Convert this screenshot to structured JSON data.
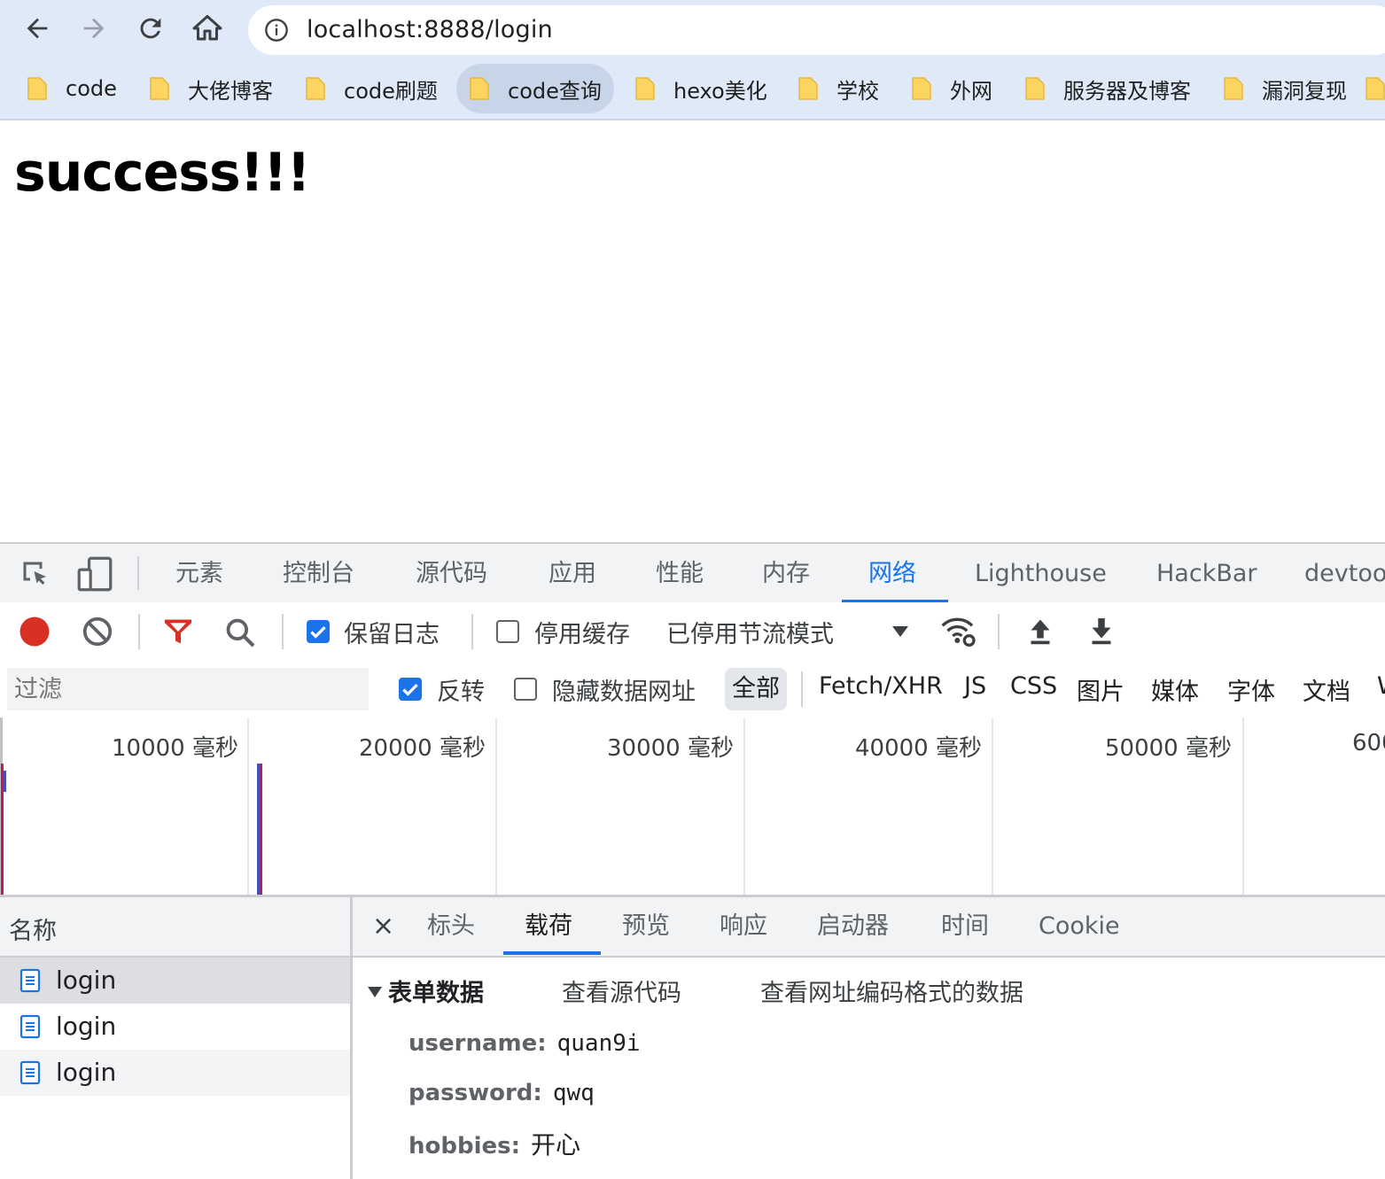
{
  "browser": {
    "url": "localhost:8888/login",
    "bookmarks": [
      {
        "label": "code"
      },
      {
        "label": "大佬博客"
      },
      {
        "label": "code刷题"
      },
      {
        "label": "code查询"
      },
      {
        "label": "hexo美化"
      },
      {
        "label": "学校"
      },
      {
        "label": "外网"
      },
      {
        "label": "服务器及博客"
      },
      {
        "label": "漏洞复现"
      }
    ]
  },
  "page": {
    "heading": "success!!!"
  },
  "devtools": {
    "tabs": [
      "元素",
      "控制台",
      "源代码",
      "应用",
      "性能",
      "内存",
      "网络",
      "Lighthouse",
      "HackBar",
      "devtoo"
    ],
    "active_tab": "网络",
    "toolbar": {
      "preserve_log_label": "保留日志",
      "preserve_log_checked": true,
      "disable_cache_label": "停用缓存",
      "disable_cache_checked": false,
      "throttling_label": "已停用节流模式"
    },
    "filter": {
      "placeholder": "过滤",
      "invert_label": "反转",
      "invert_checked": true,
      "hide_data_urls_label": "隐藏数据网址",
      "hide_data_urls_checked": false,
      "types": [
        "全部",
        "Fetch/XHR",
        "JS",
        "CSS",
        "图片",
        "媒体",
        "字体",
        "文档",
        "W"
      ],
      "active_type": "全部"
    },
    "timeline": {
      "labels": [
        "10000 毫秒",
        "20000 毫秒",
        "30000 毫秒",
        "40000 毫秒",
        "50000 毫秒",
        "600"
      ]
    },
    "requests": {
      "header": "名称",
      "rows": [
        {
          "name": "login"
        },
        {
          "name": "login"
        },
        {
          "name": "login"
        }
      ]
    },
    "detail": {
      "close_glyph": "×",
      "tabs": [
        "标头",
        "载荷",
        "预览",
        "响应",
        "启动器",
        "时间",
        "Cookie"
      ],
      "active_tab": "载荷",
      "section_title": "表单数据",
      "view_source": "查看源代码",
      "view_url_encoded": "查看网址编码格式的数据",
      "form_data": [
        {
          "key": "username:",
          "value": "quan9i"
        },
        {
          "key": "password:",
          "value": "qwq"
        },
        {
          "key": "hobbies:",
          "value": "开心"
        }
      ]
    }
  },
  "colors": {
    "accent": "#1a73e8",
    "record_red": "#d93025",
    "chrome_bg": "#dfe9f8"
  }
}
